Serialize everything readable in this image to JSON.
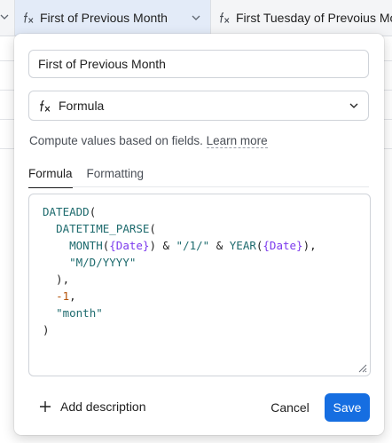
{
  "grid": {
    "active_column": {
      "name": "First of Previous Month",
      "icon": "formula-icon"
    },
    "next_column": {
      "name": "First Tuesday of Prevoius Month",
      "icon": "formula-icon"
    }
  },
  "field_editor": {
    "name_value": "First of Previous Month",
    "field_type": {
      "label": "Formula",
      "icon": "formula-icon"
    },
    "helper_text": "Compute values based on fields.",
    "learn_more": "Learn more",
    "tabs": [
      {
        "label": "Formula",
        "active": true
      },
      {
        "label": "Formatting",
        "active": false
      }
    ],
    "formula_lines": [
      [
        {
          "t": "DATEADD",
          "c": "fn"
        },
        {
          "t": "(",
          "c": "p"
        }
      ],
      [
        {
          "t": "  ",
          "c": "p"
        },
        {
          "t": "DATETIME_PARSE",
          "c": "fn"
        },
        {
          "t": "(",
          "c": "p"
        }
      ],
      [
        {
          "t": "    ",
          "c": "p"
        },
        {
          "t": "MONTH",
          "c": "fn"
        },
        {
          "t": "(",
          "c": "p"
        },
        {
          "t": "{Date}",
          "c": "ref"
        },
        {
          "t": ") & ",
          "c": "p"
        },
        {
          "t": "\"/1/\"",
          "c": "str"
        },
        {
          "t": " & ",
          "c": "p"
        },
        {
          "t": "YEAR",
          "c": "fn"
        },
        {
          "t": "(",
          "c": "p"
        },
        {
          "t": "{Date}",
          "c": "ref"
        },
        {
          "t": "),",
          "c": "p"
        }
      ],
      [
        {
          "t": "    ",
          "c": "p"
        },
        {
          "t": "\"M/D/YYYY\"",
          "c": "str"
        }
      ],
      [
        {
          "t": "  ),",
          "c": "p"
        }
      ],
      [
        {
          "t": "  ",
          "c": "p"
        },
        {
          "t": "-1",
          "c": "num"
        },
        {
          "t": ",",
          "c": "p"
        }
      ],
      [
        {
          "t": "  ",
          "c": "p"
        },
        {
          "t": "\"month\"",
          "c": "str"
        }
      ],
      [
        {
          "t": ")",
          "c": "p"
        }
      ]
    ],
    "footer": {
      "add_description": "Add description",
      "cancel": "Cancel",
      "save": "Save"
    }
  },
  "colors": {
    "accent": "#166ee1",
    "function": "#1e6b6e",
    "field_reference": "#7c3aed",
    "number": "#b45309",
    "active_header_bg": "#e3ebf8"
  }
}
